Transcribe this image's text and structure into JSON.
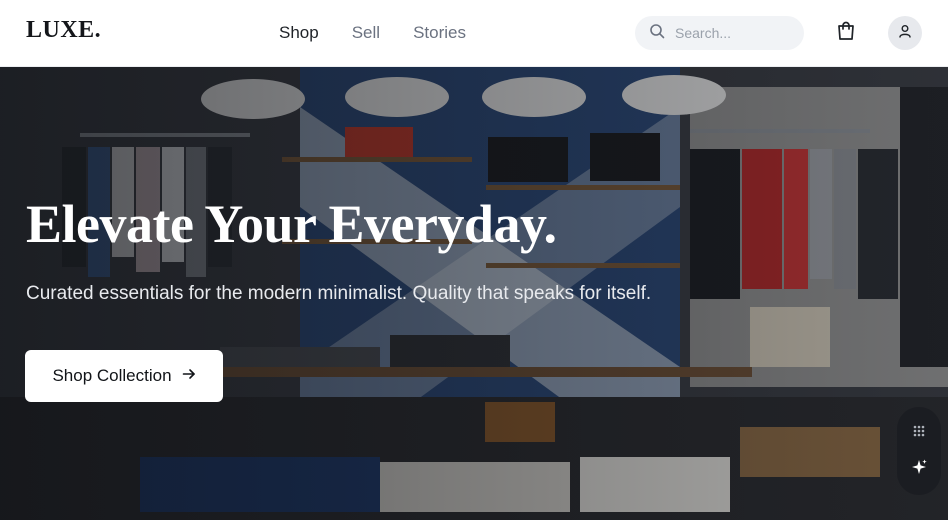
{
  "brand": {
    "logo": "LUXE."
  },
  "nav": {
    "items": [
      {
        "label": "Shop",
        "active": true
      },
      {
        "label": "Sell",
        "active": false
      },
      {
        "label": "Stories",
        "active": false
      }
    ]
  },
  "search": {
    "placeholder": "Search...",
    "value": "",
    "icon": "search-icon"
  },
  "header_actions": {
    "cart_icon": "shopping-bag-icon",
    "avatar_icon": "user-icon"
  },
  "hero": {
    "title": "Elevate Your Everyday.",
    "subtitle": "Curated essentials for the modern minimalist. Quality that speaks for itself.",
    "cta_label": "Shop Collection",
    "cta_icon": "arrow-right-icon"
  },
  "floating_tools": [
    {
      "icon": "grid-dots-icon"
    },
    {
      "icon": "sparkle-icon"
    }
  ],
  "colors": {
    "header_bg": "#ffffff",
    "accent_dark": "#14161a",
    "nav_active": "#1f2328",
    "nav_inactive": "#6b7280",
    "search_bg": "#f1f3f6",
    "cta_bg": "#ffffff"
  }
}
